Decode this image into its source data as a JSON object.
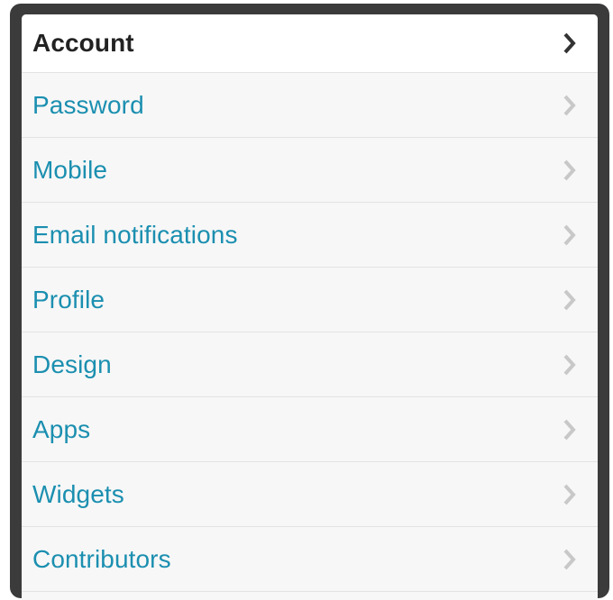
{
  "settings_nav": {
    "items": [
      {
        "label": "Account",
        "active": true
      },
      {
        "label": "Password",
        "active": false
      },
      {
        "label": "Mobile",
        "active": false
      },
      {
        "label": "Email notifications",
        "active": false
      },
      {
        "label": "Profile",
        "active": false
      },
      {
        "label": "Design",
        "active": false
      },
      {
        "label": "Apps",
        "active": false
      },
      {
        "label": "Widgets",
        "active": false
      },
      {
        "label": "Contributors",
        "active": false
      }
    ],
    "item_icon": "chevron-right-icon",
    "colors": {
      "frame": "#3b3b3b",
      "link": "#1b8fb0",
      "active_text": "#222222",
      "chevron_inactive": "#c8c8c8",
      "chevron_active": "#333333",
      "row_background": "#f7f7f7",
      "active_background": "#ffffff"
    }
  }
}
